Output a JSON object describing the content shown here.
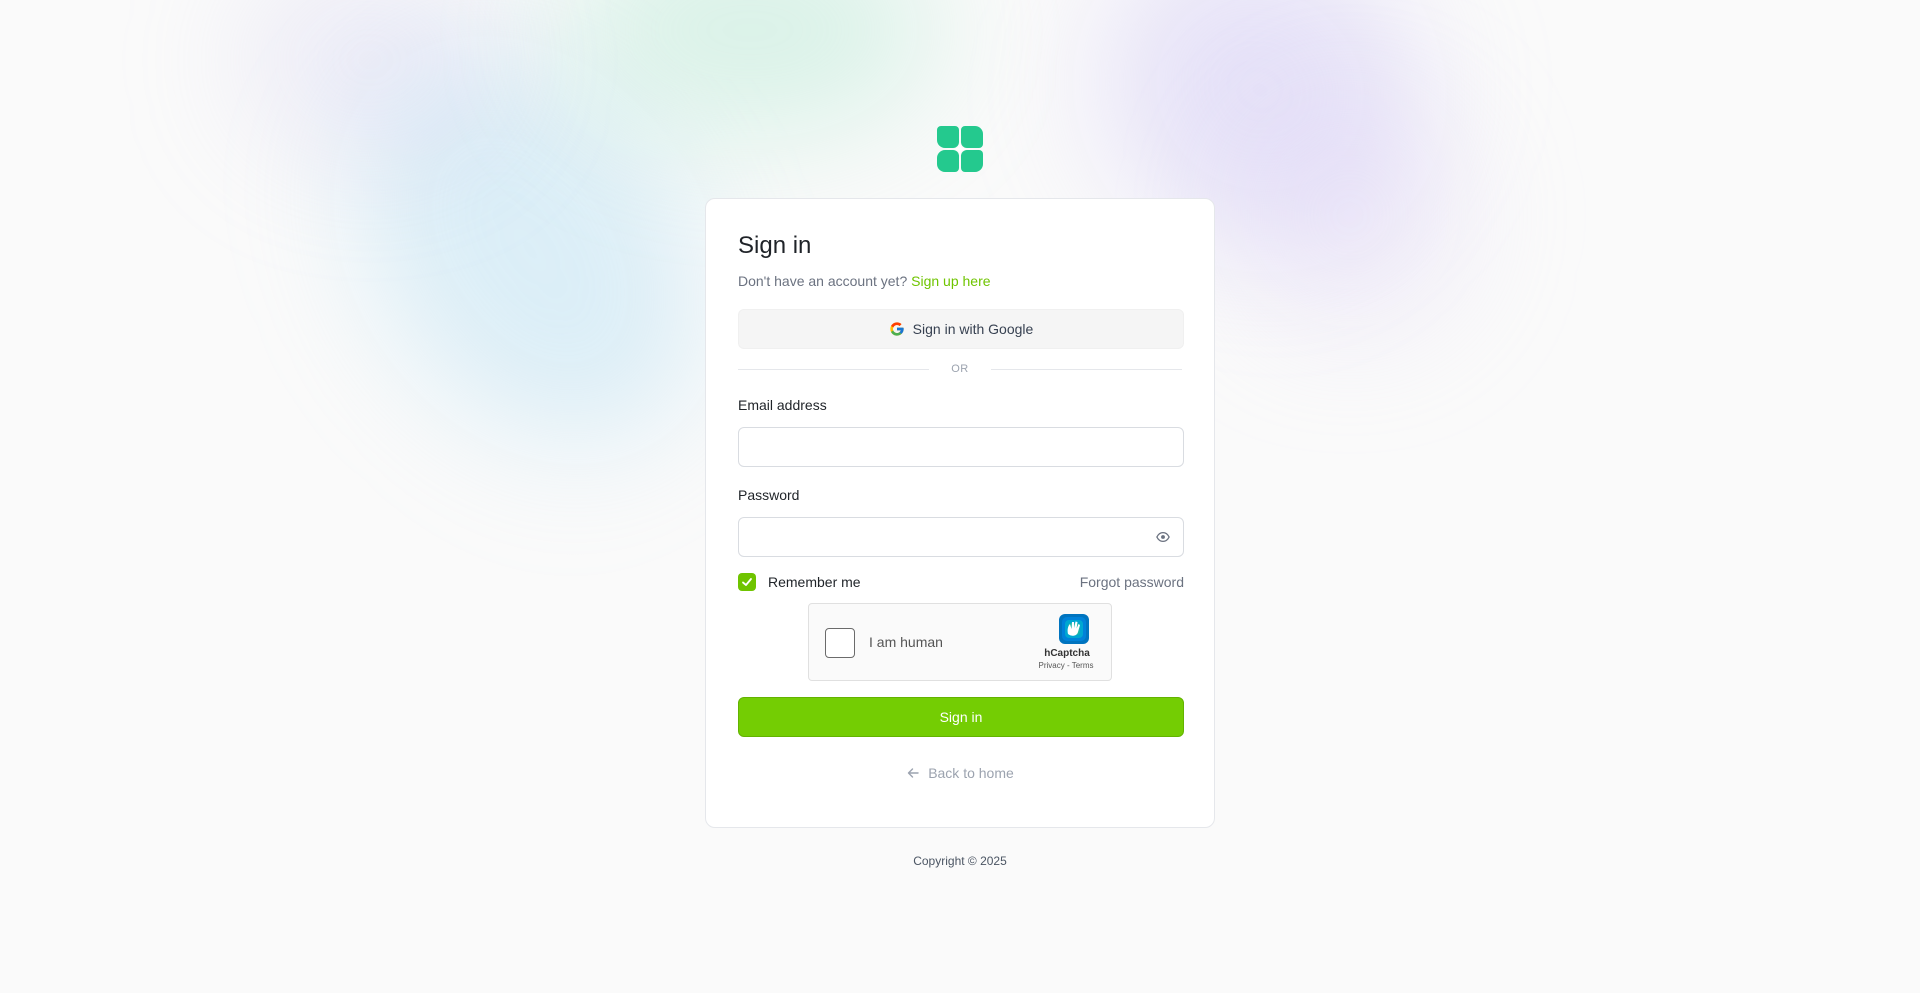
{
  "brand": {
    "logo_icon": "clover-logo-icon",
    "accent_color": "#74cd03",
    "logo_color": "#24c98e"
  },
  "signin": {
    "title": "Sign in",
    "subtitle_prefix": "Don't have an account yet?",
    "signup_link": "Sign up here",
    "google_button": "Sign in with Google",
    "divider_text": "OR",
    "email_label": "Email address",
    "email_value": "",
    "email_placeholder": "",
    "password_label": "Password",
    "password_value": "",
    "password_placeholder": "",
    "remember_label": "Remember me",
    "remember_checked": true,
    "forgot_link": "Forgot password",
    "submit_button": "Sign in",
    "back_home": "Back to home"
  },
  "captcha": {
    "label": "I am human",
    "brand": "hCaptcha",
    "links": "Privacy - Terms"
  },
  "footer": {
    "copyright": "Copyright © 2025"
  }
}
